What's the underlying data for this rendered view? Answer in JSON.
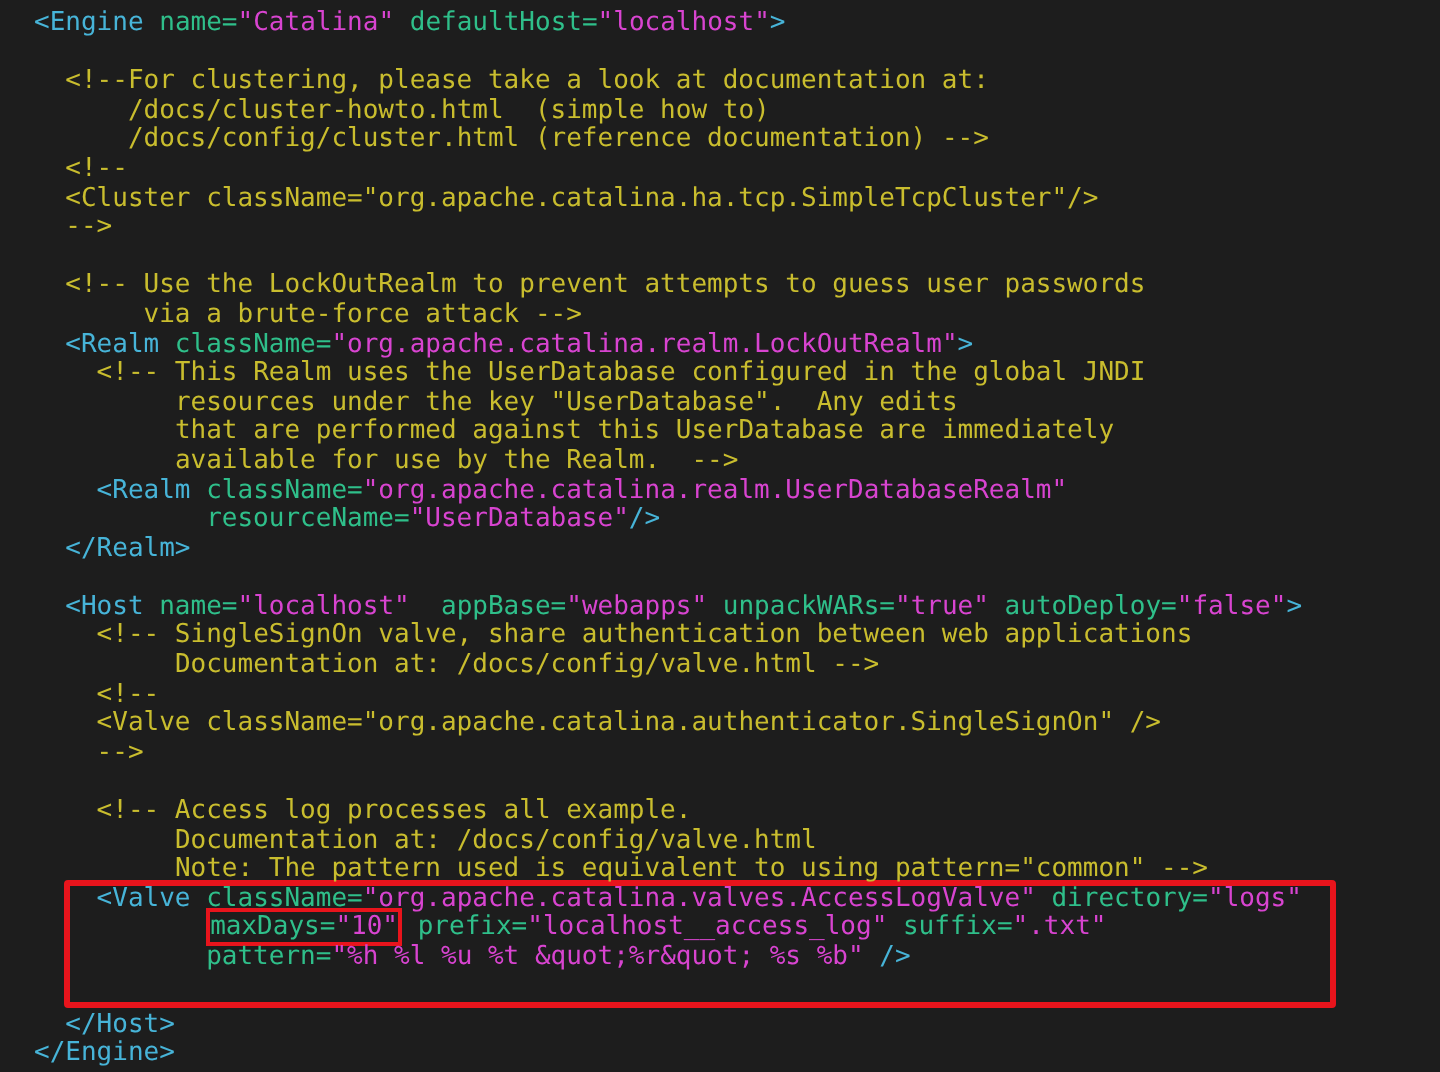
{
  "blocks": [
    {
      "highlighted": false,
      "paragraphs": [
        [
          [
            {
              "kind": "tag",
              "text": "<Engine"
            },
            {
              "kind": "attr",
              "text": " name="
            },
            {
              "kind": "value",
              "text": "\"Catalina\""
            },
            {
              "kind": "attr",
              "text": " defaultHost="
            },
            {
              "kind": "value",
              "text": "\"localhost\""
            },
            {
              "kind": "tag",
              "text": ">"
            }
          ]
        ],
        [
          [
            {
              "kind": "comment",
              "text": "  <!--For clustering, please take a look at documentation at:"
            }
          ],
          [
            {
              "kind": "comment",
              "text": "      /docs/cluster-howto.html  (simple how to)"
            }
          ],
          [
            {
              "kind": "comment",
              "text": "      /docs/config/cluster.html (reference documentation) -->"
            }
          ],
          [
            {
              "kind": "comment",
              "text": "  <!--"
            }
          ],
          [
            {
              "kind": "comment",
              "text": "  <Cluster className=\"org.apache.catalina.ha.tcp.SimpleTcpCluster\"/>"
            }
          ],
          [
            {
              "kind": "comment",
              "text": "  -->"
            }
          ]
        ],
        [
          [
            {
              "kind": "comment",
              "text": "  <!-- Use the LockOutRealm to prevent attempts to guess user passwords"
            }
          ],
          [
            {
              "kind": "comment",
              "text": "       via a brute-force attack -->"
            }
          ],
          [
            {
              "kind": "tag",
              "text": "  <Realm"
            },
            {
              "kind": "attr",
              "text": " className="
            },
            {
              "kind": "value",
              "text": "\"org.apache.catalina.realm.LockOutRealm\""
            },
            {
              "kind": "tag",
              "text": ">"
            }
          ],
          [
            {
              "kind": "comment",
              "text": "    <!-- This Realm uses the UserDatabase configured in the global JNDI"
            }
          ],
          [
            {
              "kind": "comment",
              "text": "         resources under the key \"UserDatabase\".  Any edits"
            }
          ],
          [
            {
              "kind": "comment",
              "text": "         that are performed against this UserDatabase are immediately"
            }
          ],
          [
            {
              "kind": "comment",
              "text": "         available for use by the Realm.  -->"
            }
          ],
          [
            {
              "kind": "tag",
              "text": "    <Realm"
            },
            {
              "kind": "attr",
              "text": " className="
            },
            {
              "kind": "value",
              "text": "\"org.apache.catalina.realm.UserDatabaseRealm\""
            }
          ],
          [
            {
              "kind": "attr",
              "text": "           resourceName="
            },
            {
              "kind": "value",
              "text": "\"UserDatabase\""
            },
            {
              "kind": "tag",
              "text": "/>"
            }
          ],
          [
            {
              "kind": "tag",
              "text": "  </Realm>"
            }
          ]
        ],
        [
          [
            {
              "kind": "tag",
              "text": "  <Host"
            },
            {
              "kind": "attr",
              "text": " name="
            },
            {
              "kind": "value",
              "text": "\"localhost\""
            },
            {
              "kind": "attr",
              "text": "  appBase="
            },
            {
              "kind": "value",
              "text": "\"webapps\""
            },
            {
              "kind": "attr",
              "text": " unpackWARs="
            },
            {
              "kind": "value",
              "text": "\"true\""
            },
            {
              "kind": "attr",
              "text": " autoDeploy="
            },
            {
              "kind": "value",
              "text": "\"false\""
            },
            {
              "kind": "tag",
              "text": ">"
            }
          ],
          [
            {
              "kind": "comment",
              "text": "    <!-- SingleSignOn valve, share authentication between web applications"
            }
          ],
          [
            {
              "kind": "comment",
              "text": "         Documentation at: /docs/config/valve.html -->"
            }
          ],
          [
            {
              "kind": "comment",
              "text": "    <!--"
            }
          ],
          [
            {
              "kind": "comment",
              "text": "    <Valve className=\"org.apache.catalina.authenticator.SingleSignOn\" />"
            }
          ],
          [
            {
              "kind": "comment",
              "text": "    -->"
            }
          ]
        ],
        [
          [
            {
              "kind": "comment",
              "text": "    <!-- Access log processes all example."
            }
          ],
          [
            {
              "kind": "comment",
              "text": "         Documentation at: /docs/config/valve.html"
            }
          ],
          [
            {
              "kind": "comment",
              "text": "         Note: The pattern used is equivalent to using pattern=\"common\" -->"
            }
          ]
        ]
      ]
    },
    {
      "highlighted": true,
      "paragraphs": [
        [
          [
            {
              "kind": "tag",
              "text": "    <Valve"
            },
            {
              "kind": "attr",
              "text": " className="
            },
            {
              "kind": "value",
              "text": "\"org.apache.catalina.valves.AccessLogValve\""
            },
            {
              "kind": "attr",
              "text": " directory="
            },
            {
              "kind": "value",
              "text": "\"logs\""
            }
          ],
          [
            {
              "kind": "mark",
              "tokens": [
                {
                  "kind": "attr",
                  "text": "           maxDays="
                },
                {
                  "kind": "value",
                  "text": "\"10\""
                }
              ]
            },
            {
              "kind": "attr",
              "text": " prefix="
            },
            {
              "kind": "value",
              "text": "\"localhost__access_log\""
            },
            {
              "kind": "attr",
              "text": " suffix="
            },
            {
              "kind": "value",
              "text": "\".txt\""
            }
          ],
          [
            {
              "kind": "attr",
              "text": "           pattern="
            },
            {
              "kind": "value",
              "text": "\"%h %l %u %t &quot;%r&quot; %s %b\""
            },
            {
              "kind": "tag",
              "text": " />"
            }
          ]
        ]
      ]
    },
    {
      "highlighted": false,
      "paragraphs": [
        [
          [
            {
              "kind": "tag",
              "text": "  </Host>"
            }
          ],
          [
            {
              "kind": "tag",
              "text": "</Engine>"
            }
          ]
        ]
      ]
    }
  ]
}
